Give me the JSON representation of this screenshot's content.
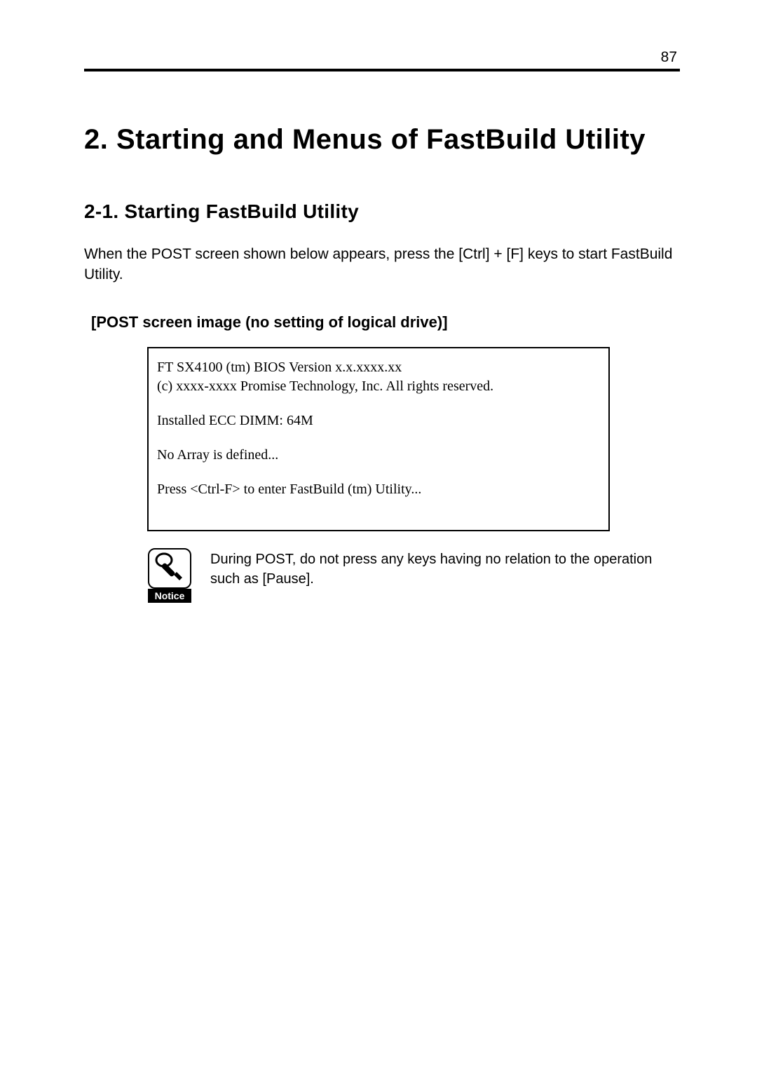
{
  "page_number": "87",
  "heading_main": "2. Starting and Menus of FastBuild Utility",
  "heading_sub": "2-1. Starting FastBuild Utility",
  "intro_text": "When the POST screen shown below appears, press the [Ctrl] + [F] keys to start FastBuild Utility.",
  "post_caption": "[POST screen image (no setting of logical drive)]",
  "post_lines": {
    "l1": "FT SX4100 (tm) BIOS Version x.x.xxxx.xx",
    "l2": "(c) xxxx-xxxx Promise Technology, Inc. All rights reserved.",
    "l3": "Installed ECC DIMM: 64M",
    "l4": "No Array is defined...",
    "l5": "Press <Ctrl-F> to enter FastBuild (tm) Utility..."
  },
  "notice": {
    "label": "Notice",
    "text": "During POST, do not press any keys having no relation to the operation such as [Pause]."
  }
}
